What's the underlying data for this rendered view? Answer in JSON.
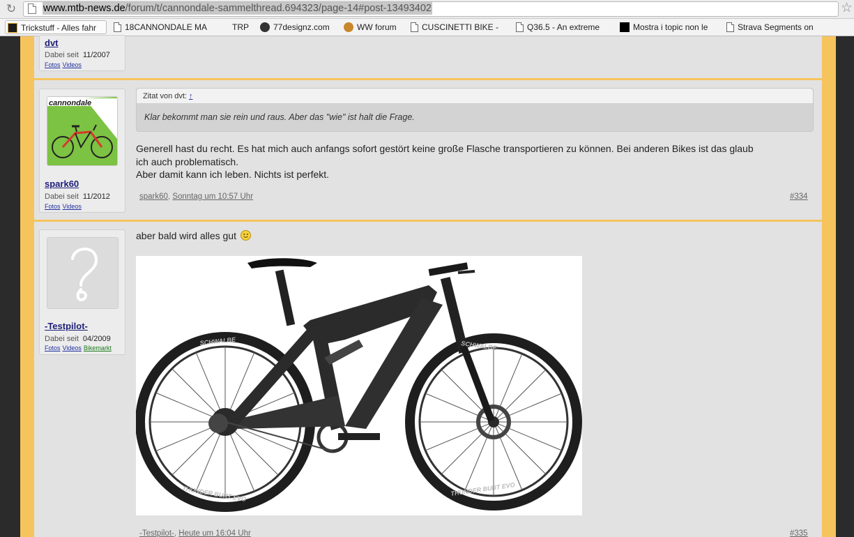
{
  "browser": {
    "url_domain": "www.mtb-news.de",
    "url_path": "/forum/t/cannondale-sammelthread.694323/page-14#post-13493402",
    "bookmarks": [
      {
        "label": "Trickstuff - Alles fahr",
        "icon": "trickstuff-icon"
      },
      {
        "label": "18CANNONDALE MA",
        "icon": "document-icon"
      },
      {
        "label": "TRP",
        "icon": "none"
      },
      {
        "label": "77designz.com",
        "icon": "77designz-icon"
      },
      {
        "label": "WW forum",
        "icon": "ww-forum-icon"
      },
      {
        "label": "CUSCINETTI BIKE -",
        "icon": "document-icon"
      },
      {
        "label": "Q36.5 - An extreme",
        "icon": "document-icon"
      },
      {
        "label": "Mostra i topic non le",
        "icon": "ad-icon"
      },
      {
        "label": "Strava Segments on",
        "icon": "document-icon"
      }
    ]
  },
  "posts": [
    {
      "user": "dvt",
      "dabei_label": "Dabei seit",
      "since": "11/2007",
      "links": [
        "Fotos",
        "Videos"
      ]
    },
    {
      "user": "spark60",
      "dabei_label": "Dabei seit",
      "since": "11/2012",
      "links": [
        "Fotos",
        "Videos"
      ],
      "quote_header": "Zitat von dvt:",
      "quote_link": "↑",
      "quote_text": "Klar bekommt man sie rein und raus. Aber das \"wie\" ist halt die Frage.",
      "body_line1": "Generell hast du recht. Es hat mich auch anfangs sofort gestört keine große Flasche transportieren zu können. Bei anderen Bikes ist das glaub",
      "body_line2": "ich auch problematisch.",
      "body_line3": "Aber damit kann ich leben. Nichts ist perfekt.",
      "meta_user": "spark60",
      "meta_time": "Sonntag um 10:57 Uhr",
      "number": "#334"
    },
    {
      "user": "-Testpilot-",
      "dabei_label": "Dabei seit",
      "since": "04/2009",
      "links": [
        "Fotos",
        "Videos",
        "Bikemarkt"
      ],
      "body": "aber bald wird alles gut",
      "tire_text_top": "SCHWALBE",
      "tire_text_bottom": "THUNDER BURT EVO",
      "meta_user": "-Testpilot-",
      "meta_time": "Heute um 16:04 Uhr",
      "number": "#335"
    }
  ]
}
